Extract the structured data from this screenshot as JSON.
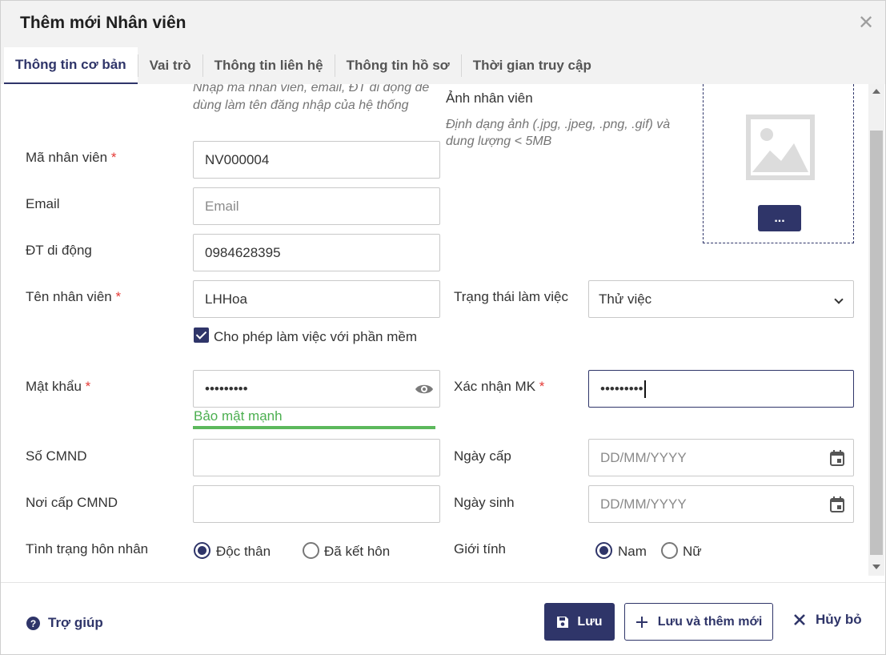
{
  "dialog": {
    "title": "Thêm mới Nhân viên",
    "close_icon": "close-icon"
  },
  "tabs": [
    {
      "label": "Thông tin cơ bản",
      "active": true
    },
    {
      "label": "Vai trò"
    },
    {
      "label": "Thông tin liên hệ"
    },
    {
      "label": "Thông tin hồ sơ"
    },
    {
      "label": "Thời gian truy cập"
    }
  ],
  "form": {
    "login_hint": "Nhập mã nhân viên, email, ĐT di động để dùng làm tên đăng nhập của hệ thống",
    "photo": {
      "label": "Ảnh nhân viên",
      "hint": "Định dạng ảnh (.jpg, .jpeg, .png, .gif) và dung lượng < 5MB",
      "browse_label": "..."
    },
    "employee_code": {
      "label": "Mã nhân viên",
      "required_mark": "*",
      "value": "NV000004"
    },
    "email": {
      "label": "Email",
      "placeholder": "Email",
      "value": ""
    },
    "mobile": {
      "label": "ĐT di động",
      "value": "0984628395"
    },
    "employee_name": {
      "label": "Tên nhân viên",
      "required_mark": "*",
      "value": "LHHoa"
    },
    "work_status": {
      "label": "Trạng thái làm việc",
      "value": "Thử việc"
    },
    "allow_software": {
      "label": "Cho phép làm việc với phần mềm",
      "checked": true
    },
    "password": {
      "label": "Mật khẩu",
      "required_mark": "*",
      "value": "•••••••••",
      "strength": "Bảo mật mạnh"
    },
    "confirm_password": {
      "label": "Xác nhận MK",
      "required_mark": "*",
      "value": "•••••••••"
    },
    "id_number": {
      "label": "Số CMND",
      "value": ""
    },
    "issue_date": {
      "label": "Ngày cấp",
      "placeholder": "DD/MM/YYYY"
    },
    "issue_place": {
      "label": "Nơi cấp CMND",
      "value": ""
    },
    "birth_date": {
      "label": "Ngày sinh",
      "placeholder": "DD/MM/YYYY"
    },
    "marital_status": {
      "label": "Tình trạng hôn nhân",
      "options": [
        "Độc thân",
        "Đã kết hôn"
      ],
      "selected": "Độc thân"
    },
    "gender": {
      "label": "Giới tính",
      "options": [
        "Nam",
        "Nữ"
      ],
      "selected": "Nam"
    }
  },
  "footer": {
    "help_label": "Trợ giúp",
    "save_label": "Lưu",
    "save_new_label": "Lưu và thêm mới",
    "cancel_label": "Hủy bỏ"
  },
  "colors": {
    "primary": "#2f3569",
    "required": "#e53935",
    "strength": "#4caf50"
  }
}
